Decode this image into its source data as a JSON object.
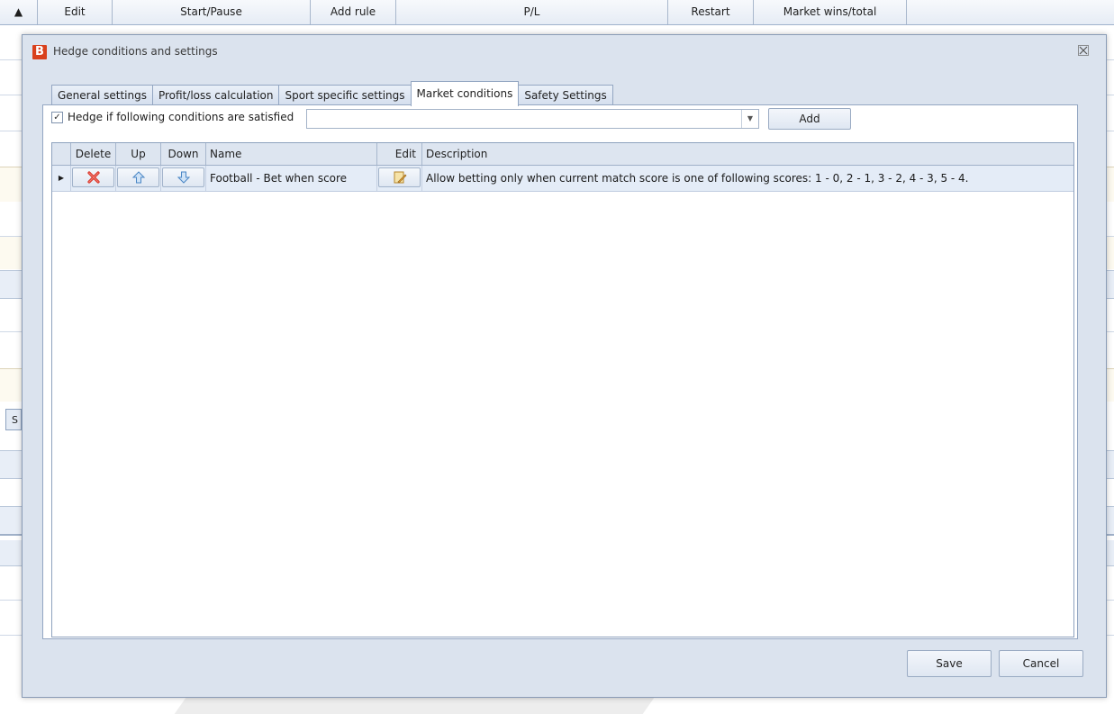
{
  "background_app": {
    "columns": [
      "Edit",
      "Start/Pause",
      "Add rule",
      "P/L",
      "Restart",
      "Market wins/total"
    ],
    "side_tab_label": "S"
  },
  "dialog": {
    "title": "Hedge conditions and settings",
    "logo_text": "B",
    "tabs": [
      {
        "label": "General settings"
      },
      {
        "label": "Profit/loss calculation"
      },
      {
        "label": "Sport specific settings"
      },
      {
        "label": "Market conditions",
        "active": true
      },
      {
        "label": "Safety Settings"
      }
    ],
    "condition_checkbox": {
      "label": "Hedge if following conditions are satisfied",
      "checked": true
    },
    "condition_combo": {
      "value": ""
    },
    "add_label": "Add",
    "grid": {
      "columns": [
        "Delete",
        "Up",
        "Down",
        "Name",
        "Edit",
        "Description"
      ],
      "rows": [
        {
          "name": "Football - Bet when score",
          "description": "Allow betting only when current match score is one of following scores: 1 - 0, 2 - 1, 3 - 2, 4 - 3, 5 - 4."
        }
      ]
    },
    "save_label": "Save",
    "cancel_label": "Cancel"
  },
  "colors": {
    "dialog_bg": "#dbe3ee",
    "accent_logo": "#d9401c",
    "selected_row": "#e4ecf7"
  },
  "icons": [
    "sort-up-icon",
    "app-logo-icon",
    "close-icon",
    "delete-x-icon",
    "arrow-up-icon",
    "arrow-down-icon",
    "edit-note-icon",
    "row-indicator-icon",
    "dropdown-arrow-icon"
  ]
}
